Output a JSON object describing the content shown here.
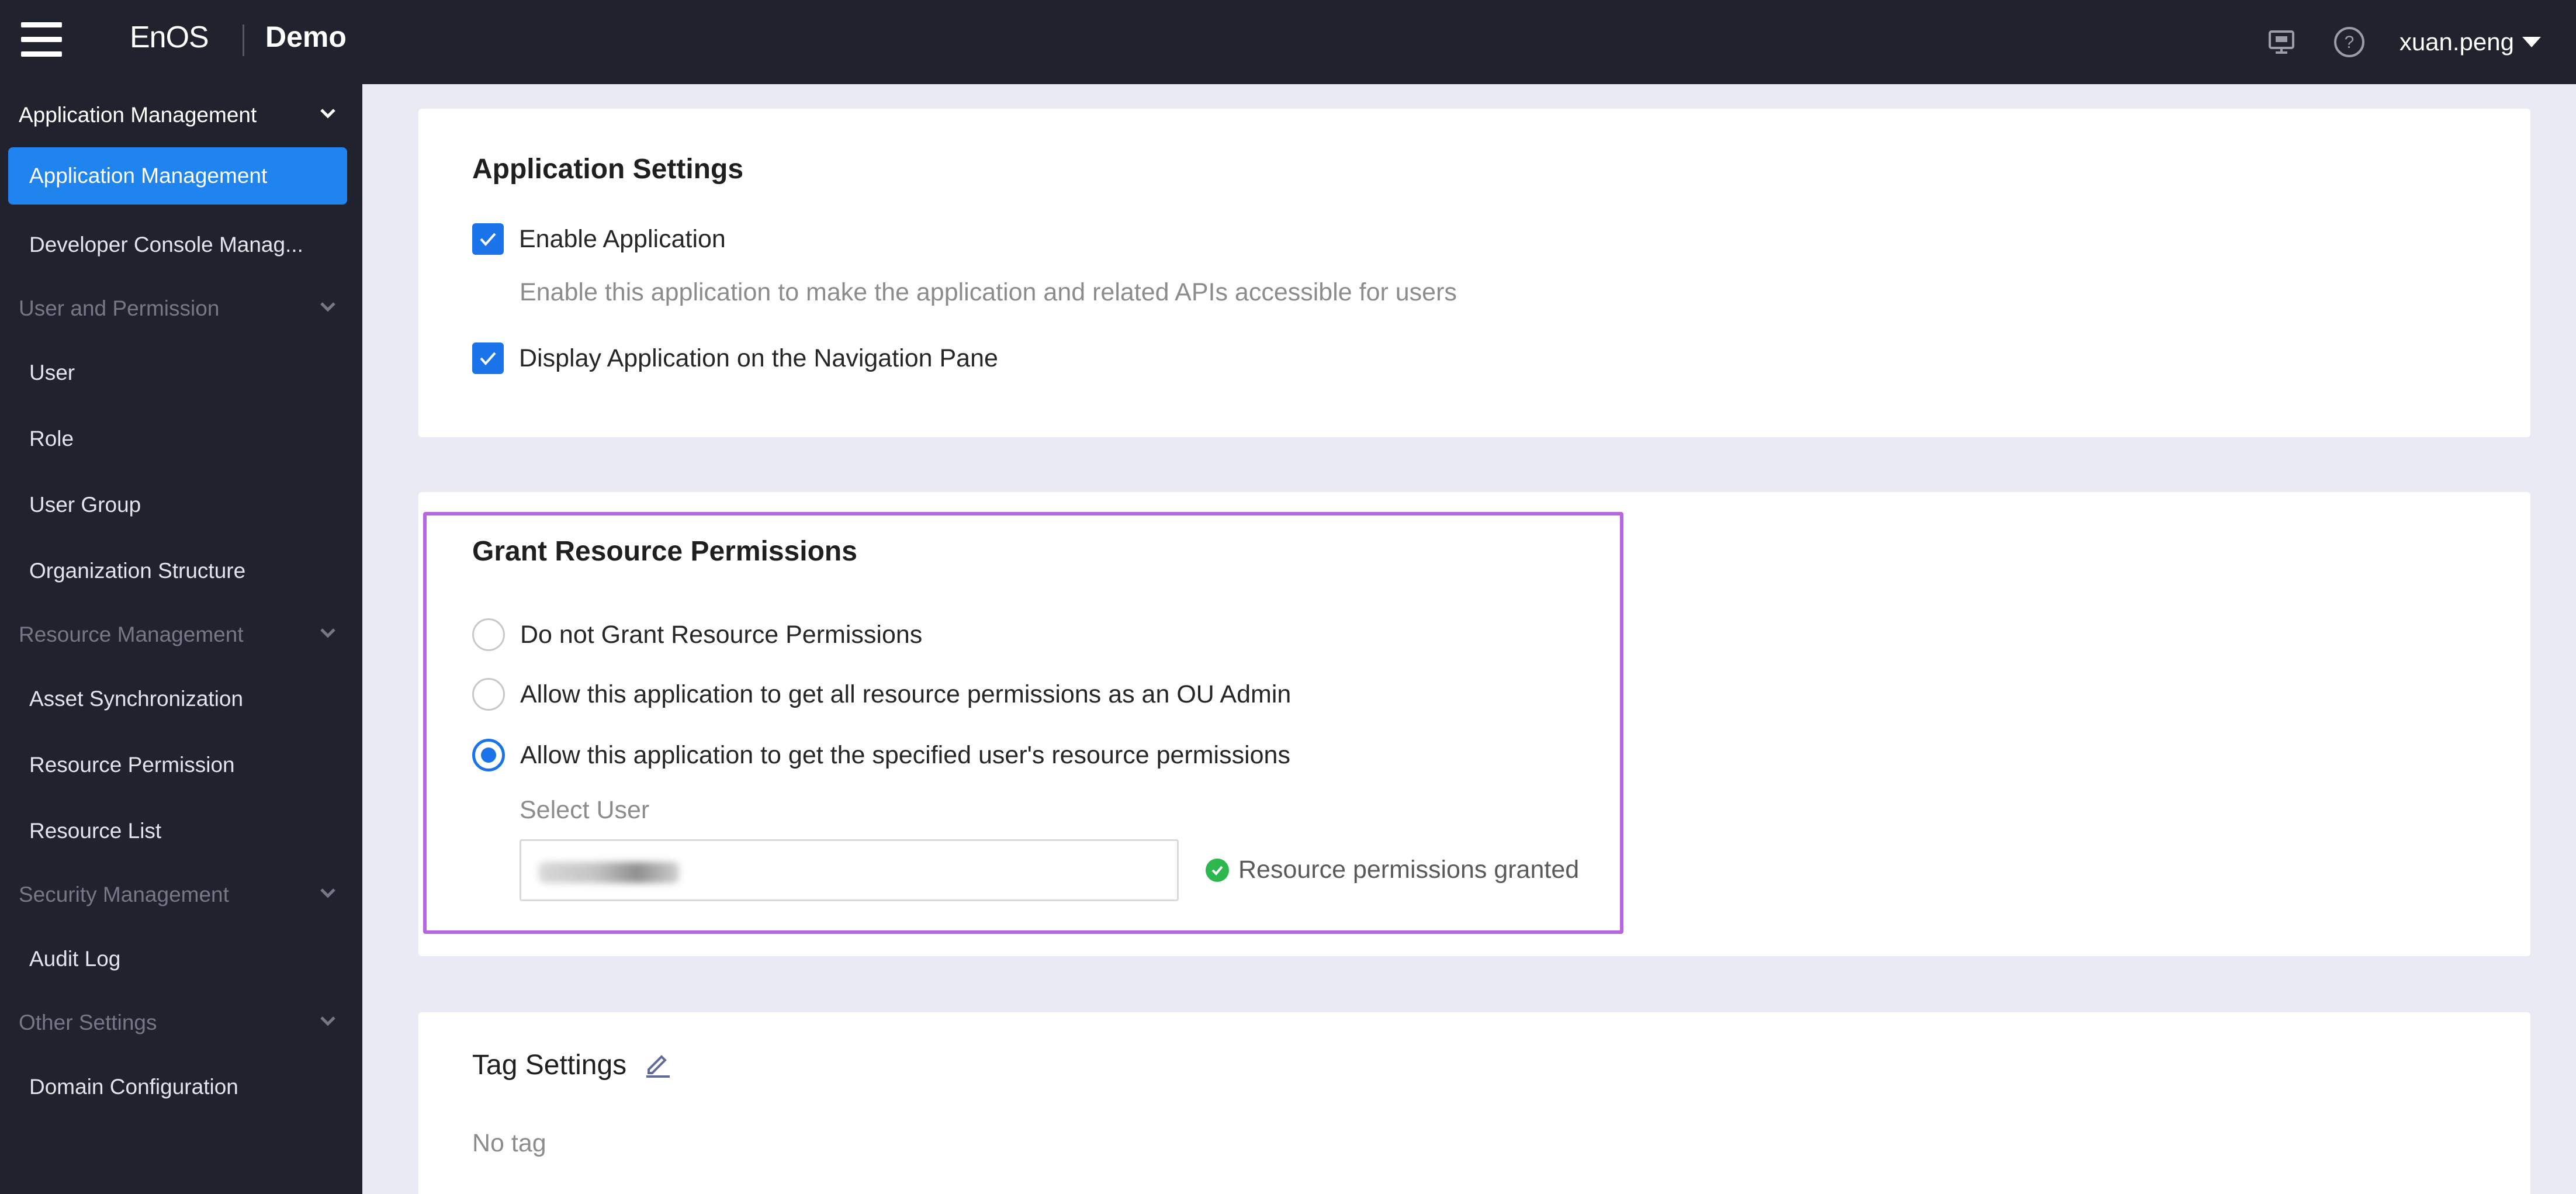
{
  "topbar": {
    "brand": "EnOS",
    "org_name": "Demo",
    "icons": [
      "screen-icon",
      "help-icon"
    ],
    "username": "xuan.peng"
  },
  "sidebar": {
    "groups": [
      {
        "label": "Application Management",
        "state": "active",
        "items": [
          {
            "label": "Application Management",
            "selected": true
          },
          {
            "label": "Developer Console Manag..."
          }
        ]
      },
      {
        "label": "User and Permission",
        "state": "muted",
        "items": [
          {
            "label": "User"
          },
          {
            "label": "Role"
          },
          {
            "label": "User Group"
          },
          {
            "label": "Organization Structure"
          }
        ]
      },
      {
        "label": "Resource Management",
        "state": "muted",
        "items": [
          {
            "label": "Asset Synchronization"
          },
          {
            "label": "Resource Permission"
          },
          {
            "label": "Resource List"
          }
        ]
      },
      {
        "label": "Security Management",
        "state": "muted",
        "items": [
          {
            "label": "Audit Log"
          }
        ]
      },
      {
        "label": "Other Settings",
        "state": "muted",
        "items": [
          {
            "label": "Domain Configuration"
          }
        ]
      }
    ]
  },
  "app_settings": {
    "title": "Application Settings",
    "enable_label": "Enable Application",
    "enable_checked": true,
    "enable_hint": "Enable this application to make the application and related APIs accessible for users",
    "display_label": "Display Application on the Navigation Pane",
    "display_checked": true
  },
  "grant_permissions": {
    "title": "Grant Resource Permissions",
    "options": [
      {
        "label": "Do not Grant Resource Permissions",
        "checked": false
      },
      {
        "label": "Allow this application to get all resource permissions as an OU Admin",
        "checked": false
      },
      {
        "label": "Allow this application to get the specified user's resource permissions",
        "checked": true
      }
    ],
    "select_user_label": "Select User",
    "select_user_value": "(blurred)",
    "status_text": "Resource permissions granted"
  },
  "tag_settings": {
    "title": "Tag Settings",
    "empty_text": "No tag"
  },
  "colors": {
    "sidebar_bg": "#20222e",
    "accent_blue": "#1a73e8",
    "selected_nav": "#1f84ee",
    "highlight_border": "#b866e0",
    "success_green": "#2db84d",
    "page_bg": "#e9eaf4"
  }
}
